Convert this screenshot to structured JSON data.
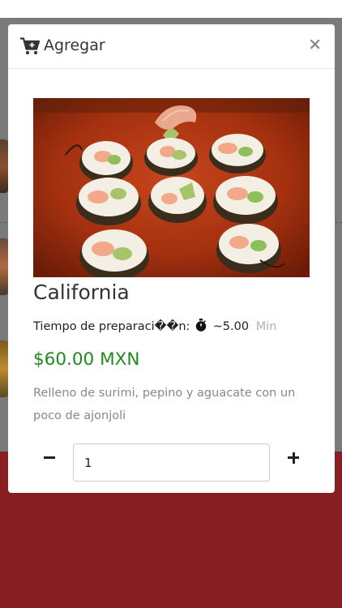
{
  "modal": {
    "title": "Agregar",
    "close_label": "×"
  },
  "product": {
    "name": "California",
    "prep_label": "Tiempo de preparaci��n:",
    "prep_time": "~5.00",
    "prep_unit": "Min",
    "price": "$60.00 MXN",
    "description": "Relleno de surimi, pepino y aguacate con un poco de ajonjoli"
  },
  "quantity": {
    "value": "1"
  },
  "icons": {
    "cart": "cart-plus-icon",
    "timer": "stopwatch-icon",
    "minus": "minus-icon",
    "plus": "plus-icon",
    "close": "close-icon"
  },
  "colors": {
    "price": "#1f8a1f",
    "footer_brand": "#861e22",
    "overlay": "#7a7a7a"
  }
}
